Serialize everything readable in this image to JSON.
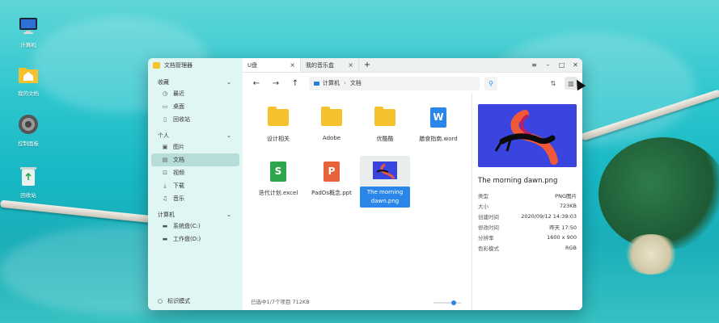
{
  "desktop": {
    "icons": [
      {
        "label": "计算机",
        "icon": "monitor-icon"
      },
      {
        "label": "我的文档",
        "icon": "home-folder-icon"
      },
      {
        "label": "控制面板",
        "icon": "gear-icon"
      },
      {
        "label": "回收站",
        "icon": "trash-icon"
      }
    ]
  },
  "window": {
    "app_title": "文档管理器",
    "sidebar": {
      "groups": [
        {
          "title": "收藏",
          "items": [
            {
              "label": "最近",
              "icon": "clock-icon"
            },
            {
              "label": "桌面",
              "icon": "desktop-icon"
            },
            {
              "label": "回收站",
              "icon": "trash-icon"
            }
          ]
        },
        {
          "title": "个人",
          "items": [
            {
              "label": "图片",
              "icon": "image-icon"
            },
            {
              "label": "文档",
              "icon": "document-icon"
            },
            {
              "label": "视频",
              "icon": "video-icon"
            },
            {
              "label": "下载",
              "icon": "download-icon"
            },
            {
              "label": "音乐",
              "icon": "music-icon"
            }
          ]
        },
        {
          "title": "计算机",
          "items": [
            {
              "label": "系统盘(C:)",
              "icon": "disk-icon"
            },
            {
              "label": "工作盘(D:)",
              "icon": "disk-icon"
            }
          ]
        }
      ],
      "footer": "标识模式"
    },
    "tabs": [
      {
        "label": "U盘",
        "active": true
      },
      {
        "label": "我的音乐盒",
        "active": false
      }
    ],
    "tab_add": "+",
    "breadcrumb": [
      "计算机",
      "文档"
    ],
    "files": [
      {
        "name": "设计相关",
        "type": "folder"
      },
      {
        "name": "Adobe",
        "type": "folder"
      },
      {
        "name": "优酷酷",
        "type": "folder"
      },
      {
        "name": "膳食指南.word",
        "type": "word"
      },
      {
        "name": "迭代计划.excel",
        "type": "excel"
      },
      {
        "name": "PadOs概念.ppt",
        "type": "ppt"
      },
      {
        "name": "The morning dawn.png",
        "type": "image",
        "selected": true
      }
    ],
    "details": {
      "title": "The morning dawn.png",
      "rows": [
        {
          "key": "类型",
          "value": "PNG图片"
        },
        {
          "key": "大小",
          "value": "723KB"
        },
        {
          "key": "创建时间",
          "value": "2020/09/12 14:39:03"
        },
        {
          "key": "修改时间",
          "value": "昨天 17:50"
        },
        {
          "key": "分辨率",
          "value": "1600 x 900"
        },
        {
          "key": "色彩模式",
          "value": "RGB"
        }
      ]
    },
    "status": "已选中1/7个项目  712KB",
    "zoom_level": 0.8,
    "colors": {
      "accent": "#2b86ea",
      "folder": "#f5c22d",
      "word": "#2b86ea",
      "excel": "#2ea64b",
      "ppt": "#e8623a",
      "preview_bg": "#3a45e0"
    }
  }
}
